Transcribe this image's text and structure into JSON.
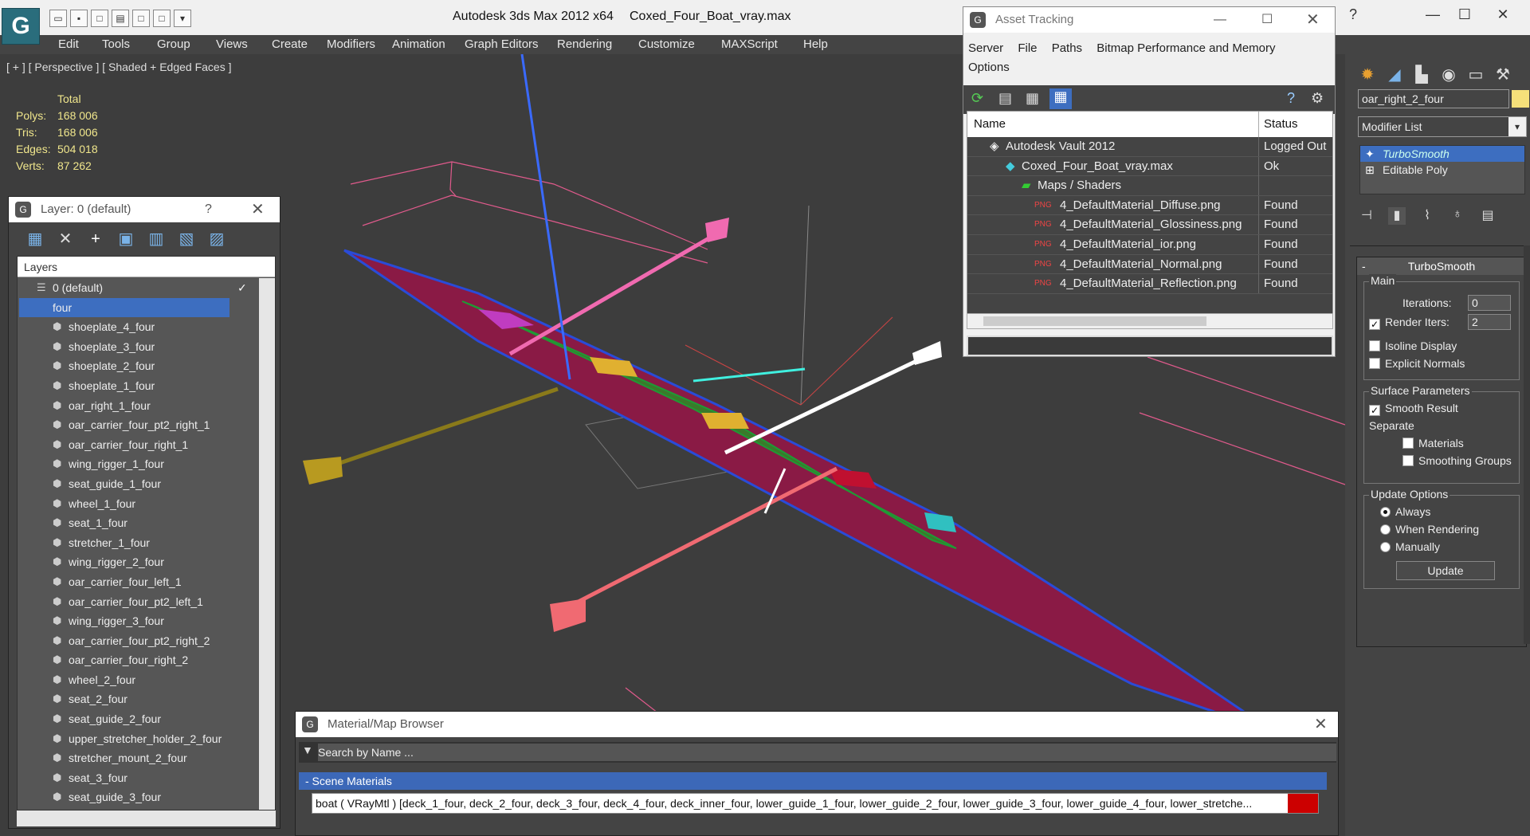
{
  "window": {
    "app_title": "Autodesk 3ds Max  2012 x64",
    "file_title": "Coxed_Four_Boat_vray.max",
    "logo_glyph": "G"
  },
  "menu": [
    "Edit",
    "Tools",
    "Group",
    "Views",
    "Create",
    "Modifiers",
    "Animation",
    "Graph Editors",
    "Rendering",
    "Customize",
    "MAXScript",
    "Help"
  ],
  "viewport": {
    "label": "[ + ] [ Perspective ] [ Shaded + Edged Faces ]",
    "stats": {
      "header": "Total",
      "polys_label": "Polys:",
      "polys": "168 006",
      "tris_label": "Tris:",
      "tris": "168 006",
      "edges_label": "Edges:",
      "edges": "504 018",
      "verts_label": "Verts:",
      "verts": "87 262"
    }
  },
  "layer_panel": {
    "title": "Layer: 0 (default)",
    "help": "?",
    "column_header": "Layers",
    "items": [
      "0 (default)",
      "four",
      "shoeplate_4_four",
      "shoeplate_3_four",
      "shoeplate_2_four",
      "shoeplate_1_four",
      "oar_right_1_four",
      "oar_carrier_four_pt2_right_1",
      "oar_carrier_four_right_1",
      "wing_rigger_1_four",
      "seat_guide_1_four",
      "wheel_1_four",
      "seat_1_four",
      "stretcher_1_four",
      "wing_rigger_2_four",
      "oar_carrier_four_left_1",
      "oar_carrier_four_pt2_left_1",
      "wing_rigger_3_four",
      "oar_carrier_four_pt2_right_2",
      "oar_carrier_four_right_2",
      "wheel_2_four",
      "seat_2_four",
      "seat_guide_2_four",
      "upper_stretcher_holder_2_four",
      "stretcher_mount_2_four",
      "seat_3_four",
      "seat_guide_3_four"
    ]
  },
  "asset_panel": {
    "title": "Asset Tracking",
    "menu": [
      "Server",
      "File",
      "Paths",
      "Bitmap Performance and Memory",
      "Options"
    ],
    "col_name": "Name",
    "col_status": "Status",
    "rows": [
      {
        "name": "Autodesk Vault 2012",
        "status": "Logged Out"
      },
      {
        "name": "Coxed_Four_Boat_vray.max",
        "status": "Ok"
      },
      {
        "name": "Maps / Shaders",
        "status": ""
      },
      {
        "name": "4_DefaultMaterial_Diffuse.png",
        "status": "Found"
      },
      {
        "name": "4_DefaultMaterial_Glossiness.png",
        "status": "Found"
      },
      {
        "name": "4_DefaultMaterial_ior.png",
        "status": "Found"
      },
      {
        "name": "4_DefaultMaterial_Normal.png",
        "status": "Found"
      },
      {
        "name": "4_DefaultMaterial_Reflection.png",
        "status": "Found"
      }
    ]
  },
  "material_browser": {
    "title": "Material/Map Browser",
    "search_placeholder": "Search by Name ...",
    "group": "- Scene Materials",
    "item": "boat ( VRayMtl ) [deck_1_four, deck_2_four, deck_3_four, deck_4_four, deck_inner_four, lower_guide_1_four, lower_guide_2_four, lower_guide_3_four, lower_guide_4_four, lower_stretche..."
  },
  "command_panel": {
    "object_name": "oar_right_2_four",
    "modifier_list": "Modifier List",
    "stack": [
      "TurboSmooth",
      "Editable Poly"
    ],
    "rollout_title": "TurboSmooth",
    "main_group": "Main",
    "iterations_label": "Iterations:",
    "iterations": "0",
    "render_iters_label": "Render Iters:",
    "render_iters": "2",
    "isoline": "Isoline Display",
    "explicit_normals": "Explicit Normals",
    "surface_group": "Surface Parameters",
    "smooth_result": "Smooth Result",
    "separate": "Separate",
    "materials": "Materials",
    "smoothing_groups": "Smoothing Groups",
    "update_group": "Update Options",
    "always": "Always",
    "when_rendering": "When Rendering",
    "manually": "Manually",
    "update_btn": "Update",
    "object_color": "#f5e07a"
  }
}
